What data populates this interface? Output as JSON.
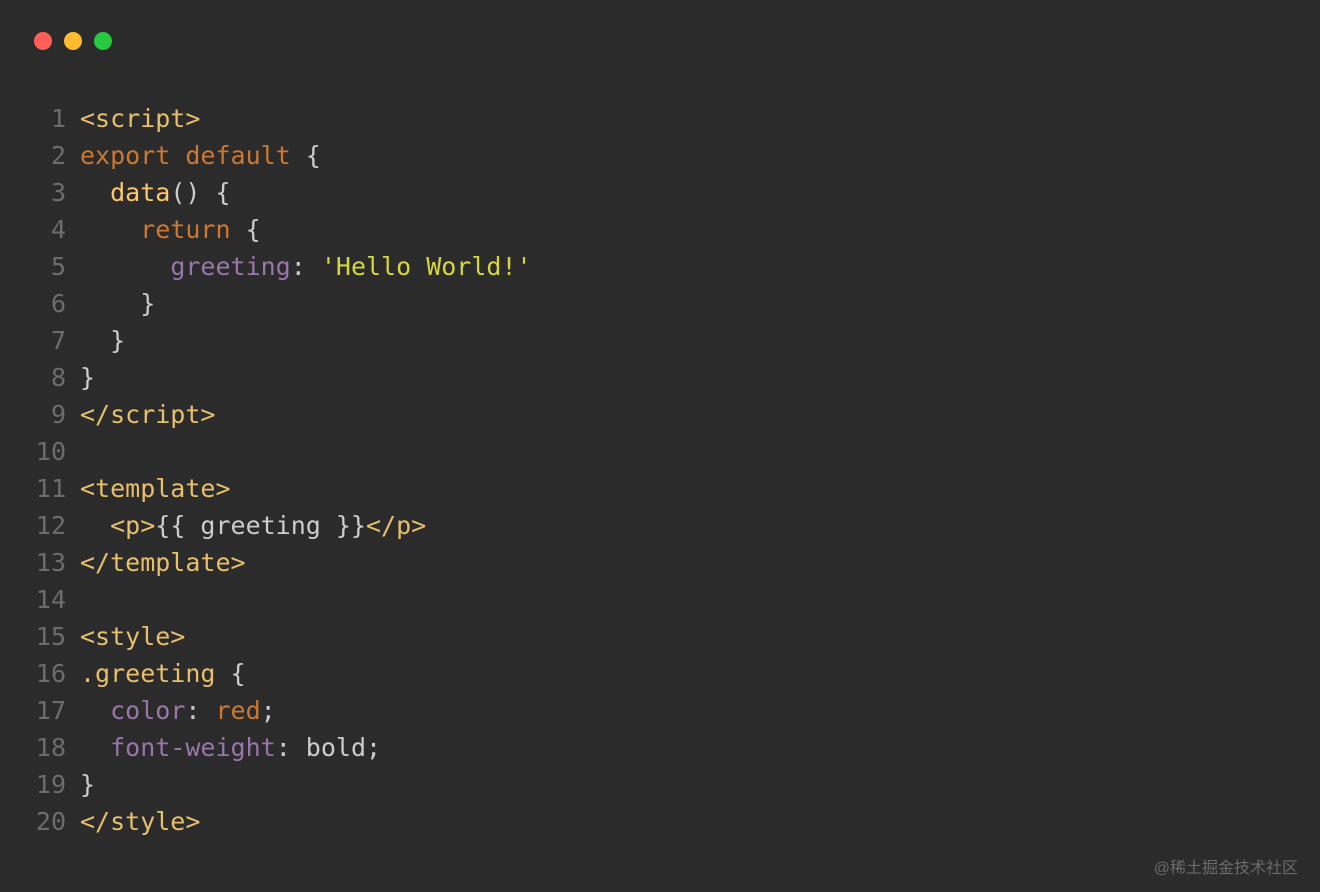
{
  "traffic_lights": {
    "red": "#ff5f57",
    "yellow": "#febc2e",
    "green": "#28c840"
  },
  "code": {
    "lines": [
      {
        "num": "1",
        "tokens": [
          {
            "t": "<script>",
            "c": "tag"
          }
        ]
      },
      {
        "num": "2",
        "tokens": [
          {
            "t": "export default",
            "c": "keyword-export"
          },
          {
            "t": " {",
            "c": "punct"
          }
        ]
      },
      {
        "num": "3",
        "tokens": [
          {
            "t": "  ",
            "c": "punct"
          },
          {
            "t": "data",
            "c": "func-name"
          },
          {
            "t": "() {",
            "c": "punct"
          }
        ]
      },
      {
        "num": "4",
        "tokens": [
          {
            "t": "    ",
            "c": "punct"
          },
          {
            "t": "return",
            "c": "keyword-return"
          },
          {
            "t": " {",
            "c": "punct"
          }
        ]
      },
      {
        "num": "5",
        "tokens": [
          {
            "t": "      ",
            "c": "punct"
          },
          {
            "t": "greeting",
            "c": "prop-name"
          },
          {
            "t": ": ",
            "c": "punct"
          },
          {
            "t": "'Hello World!'",
            "c": "string-yellow"
          }
        ]
      },
      {
        "num": "6",
        "tokens": [
          {
            "t": "    }",
            "c": "punct"
          }
        ]
      },
      {
        "num": "7",
        "tokens": [
          {
            "t": "  }",
            "c": "punct"
          }
        ]
      },
      {
        "num": "8",
        "tokens": [
          {
            "t": "}",
            "c": "punct"
          }
        ]
      },
      {
        "num": "9",
        "tokens": [
          {
            "t": "</script>",
            "c": "tag"
          }
        ]
      },
      {
        "num": "10",
        "tokens": [
          {
            "t": "",
            "c": "punct"
          }
        ]
      },
      {
        "num": "11",
        "tokens": [
          {
            "t": "<template>",
            "c": "tag"
          }
        ]
      },
      {
        "num": "12",
        "tokens": [
          {
            "t": "  ",
            "c": "punct"
          },
          {
            "t": "<p>",
            "c": "tag"
          },
          {
            "t": "{{ greeting }}",
            "c": "punct"
          },
          {
            "t": "</p>",
            "c": "tag"
          }
        ]
      },
      {
        "num": "13",
        "tokens": [
          {
            "t": "</template>",
            "c": "tag"
          }
        ]
      },
      {
        "num": "14",
        "tokens": [
          {
            "t": "",
            "c": "punct"
          }
        ]
      },
      {
        "num": "15",
        "tokens": [
          {
            "t": "<style>",
            "c": "tag"
          }
        ]
      },
      {
        "num": "16",
        "tokens": [
          {
            "t": ".greeting",
            "c": "selector"
          },
          {
            "t": " {",
            "c": "punct"
          }
        ]
      },
      {
        "num": "17",
        "tokens": [
          {
            "t": "  ",
            "c": "punct"
          },
          {
            "t": "color",
            "c": "css-prop"
          },
          {
            "t": ": ",
            "c": "punct"
          },
          {
            "t": "red",
            "c": "css-val"
          },
          {
            "t": ";",
            "c": "punct"
          }
        ]
      },
      {
        "num": "18",
        "tokens": [
          {
            "t": "  ",
            "c": "punct"
          },
          {
            "t": "font-weight",
            "c": "css-prop"
          },
          {
            "t": ": ",
            "c": "punct"
          },
          {
            "t": "bold",
            "c": "punct"
          },
          {
            "t": ";",
            "c": "punct"
          }
        ]
      },
      {
        "num": "19",
        "tokens": [
          {
            "t": "}",
            "c": "punct"
          }
        ]
      },
      {
        "num": "20",
        "tokens": [
          {
            "t": "</style>",
            "c": "tag"
          }
        ]
      }
    ]
  },
  "watermark": "@稀土掘金技术社区"
}
